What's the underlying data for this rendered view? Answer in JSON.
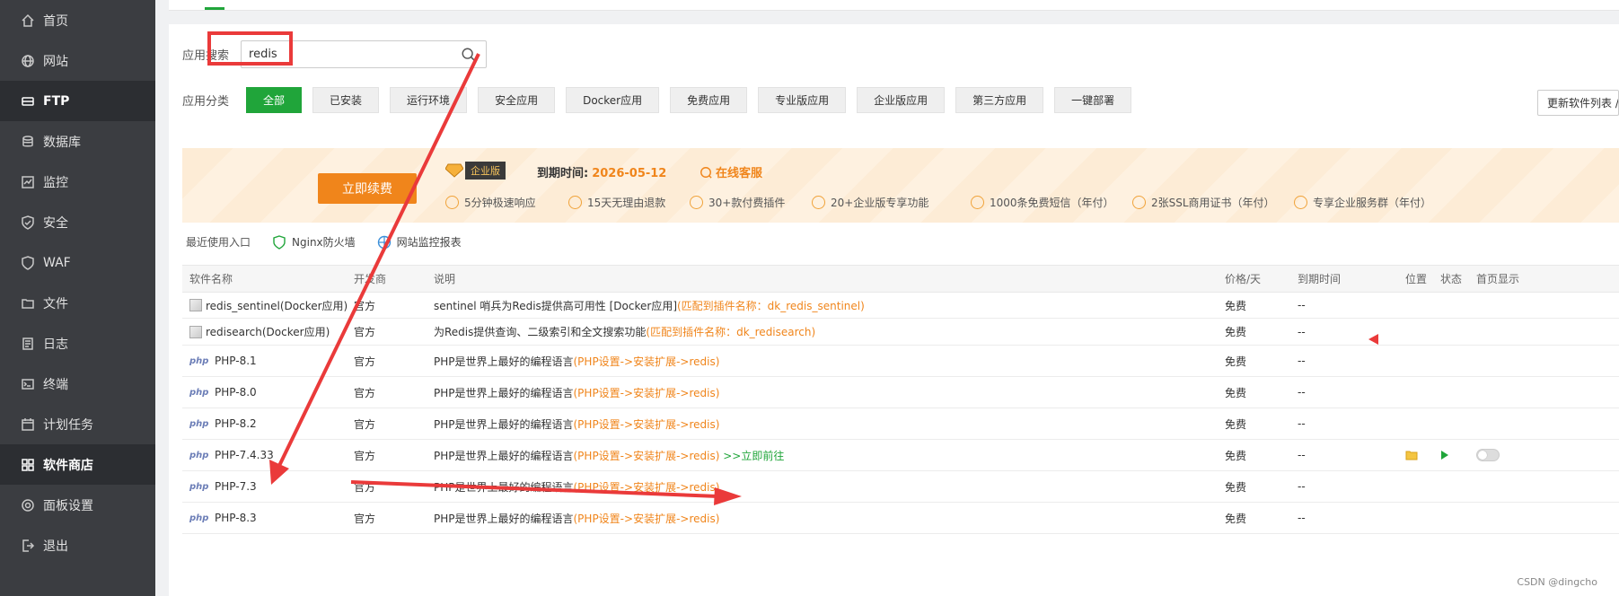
{
  "sidebar": {
    "items": [
      {
        "label": "首页",
        "icon": "home-icon",
        "active": false
      },
      {
        "label": "网站",
        "icon": "globe-icon",
        "active": false
      },
      {
        "label": "FTP",
        "icon": "ftp-icon",
        "active": true
      },
      {
        "label": "数据库",
        "icon": "database-icon",
        "active": false
      },
      {
        "label": "监控",
        "icon": "monitor-icon",
        "active": false
      },
      {
        "label": "安全",
        "icon": "shield-icon",
        "active": false
      },
      {
        "label": "WAF",
        "icon": "waf-icon",
        "active": false
      },
      {
        "label": "文件",
        "icon": "folder-icon",
        "active": false
      },
      {
        "label": "日志",
        "icon": "log-icon",
        "active": false
      },
      {
        "label": "终端",
        "icon": "terminal-icon",
        "active": false
      },
      {
        "label": "计划任务",
        "icon": "calendar-icon",
        "active": false
      },
      {
        "label": "软件商店",
        "icon": "grid-icon",
        "active": true
      },
      {
        "label": "面板设置",
        "icon": "gear-icon",
        "active": false
      },
      {
        "label": "退出",
        "icon": "logout-icon",
        "active": false
      }
    ]
  },
  "search": {
    "label": "应用搜索",
    "value": "redis"
  },
  "categories": {
    "label": "应用分类",
    "items": [
      "全部",
      "已安装",
      "运行环境",
      "安全应用",
      "Docker应用",
      "免费应用",
      "专业版应用",
      "企业版应用",
      "第三方应用",
      "一键部署"
    ],
    "active_index": 0
  },
  "update_button": "更新软件列表 /",
  "banner": {
    "renew": "立即续费",
    "edition": "企业版",
    "expire_label": "到期时间:",
    "expire_date": "2026-05-12",
    "support": "在线客服",
    "features": [
      "5分钟极速响应",
      "15天无理由退款",
      "30+款付费插件",
      "20+企业版专享功能",
      "1000条免费短信（年付）",
      "2张SSL商用证书（年付）",
      "专享企业服务群（年付）"
    ]
  },
  "recent": {
    "label": "最近使用入口",
    "items": [
      {
        "label": "Nginx防火墙",
        "icon": "waf-shield-icon"
      },
      {
        "label": "网站监控报表",
        "icon": "monitor-report-icon"
      }
    ]
  },
  "table": {
    "headers": [
      "软件名称",
      "开发商",
      "说明",
      "价格/天",
      "到期时间",
      "位置",
      "状态",
      "首页显示"
    ],
    "rows": [
      {
        "name": "redis_sentinel(Docker应用)",
        "logo": "broken",
        "dev": "官方",
        "desc": "sentinel 哨兵为Redis提供高可用性 [Docker应用]",
        "note": "(匹配到插件名称：dk_redis_sentinel)",
        "note_color": "orange",
        "price": "免费",
        "expire": "--",
        "height": 29
      },
      {
        "name": "redisearch(Docker应用)",
        "logo": "broken",
        "dev": "官方",
        "desc": "为Redis提供查询、二级索引和全文搜索功能",
        "note": "(匹配到插件名称：dk_redisearch)",
        "note_color": "orange",
        "price": "免费",
        "expire": "--",
        "height": 30
      },
      {
        "name": "PHP-8.1",
        "logo": "php",
        "dev": "官方",
        "desc": "PHP是世界上最好的编程语言",
        "note": "(PHP设置->安装扩展->redis)",
        "note_color": "orange",
        "price": "免费",
        "expire": "--",
        "height": 35
      },
      {
        "name": "PHP-8.0",
        "logo": "php",
        "dev": "官方",
        "desc": "PHP是世界上最好的编程语言",
        "note": "(PHP设置->安装扩展->redis)",
        "note_color": "orange",
        "price": "免费",
        "expire": "--",
        "height": 35
      },
      {
        "name": "PHP-8.2",
        "logo": "php",
        "dev": "官方",
        "desc": "PHP是世界上最好的编程语言",
        "note": "(PHP设置->安装扩展->redis)",
        "note_color": "orange",
        "price": "免费",
        "expire": "--",
        "height": 35
      },
      {
        "name": "PHP-7.4.33",
        "logo": "php",
        "dev": "官方",
        "desc": "PHP是世界上最好的编程语言",
        "note": "(PHP设置->安装扩展->redis)",
        "note_color": "orange",
        "link": ">>立即前往",
        "price": "免费",
        "expire": "--",
        "installed": true,
        "height": 35
      },
      {
        "name": "PHP-7.3",
        "logo": "php",
        "dev": "官方",
        "desc": "PHP是世界上最好的编程语言",
        "note": "(PHP设置->安装扩展->redis)",
        "note_color": "orange",
        "price": "免费",
        "expire": "--",
        "height": 35
      },
      {
        "name": "PHP-8.3",
        "logo": "php",
        "dev": "官方",
        "desc": "PHP是世界上最好的编程语言",
        "note": "(PHP设置->安装扩展->redis)",
        "note_color": "orange",
        "price": "免费",
        "expire": "--",
        "height": 35
      }
    ]
  },
  "watermark": "CSDN @dingcho"
}
